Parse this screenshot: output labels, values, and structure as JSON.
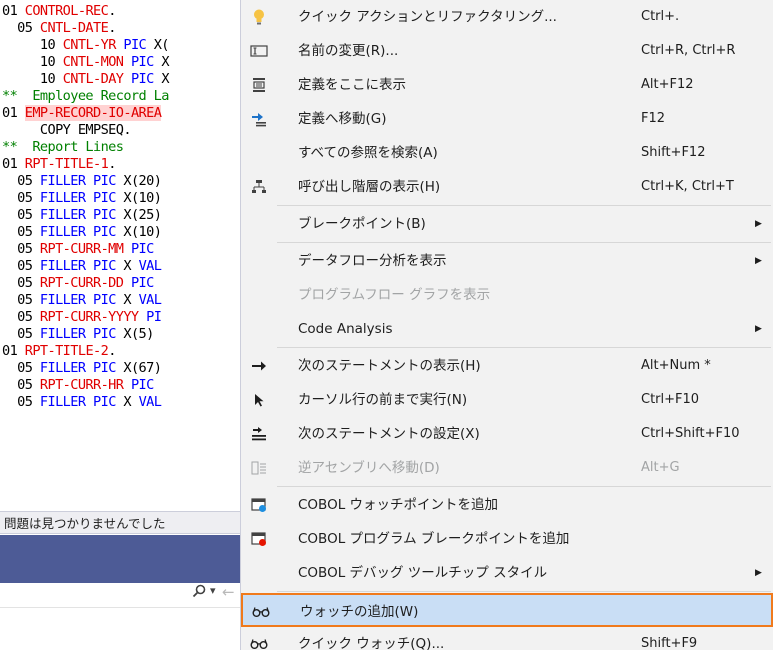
{
  "editor": {
    "lines": [
      [
        {
          "t": "01 ",
          "c": "blk"
        },
        {
          "t": "CONTROL-REC",
          "c": "red"
        },
        {
          "t": ".",
          "c": "blk"
        }
      ],
      [
        {
          "t": "  05 ",
          "c": "blk"
        },
        {
          "t": "CNTL-DATE",
          "c": "red"
        },
        {
          "t": ".",
          "c": "blk"
        }
      ],
      [
        {
          "t": "     10 ",
          "c": "blk"
        },
        {
          "t": "CNTL-YR",
          "c": "red"
        },
        {
          "t": " ",
          "c": "blk"
        },
        {
          "t": "PIC",
          "c": "blue"
        },
        {
          "t": " X(",
          "c": "blk"
        }
      ],
      [
        {
          "t": "     10 ",
          "c": "blk"
        },
        {
          "t": "CNTL-MON",
          "c": "red"
        },
        {
          "t": " ",
          "c": "blk"
        },
        {
          "t": "PIC",
          "c": "blue"
        },
        {
          "t": " X",
          "c": "blk"
        }
      ],
      [
        {
          "t": "     10 ",
          "c": "blk"
        },
        {
          "t": "CNTL-DAY",
          "c": "red"
        },
        {
          "t": " ",
          "c": "blk"
        },
        {
          "t": "PIC",
          "c": "blue"
        },
        {
          "t": " X",
          "c": "blk"
        }
      ],
      [
        {
          "t": "**  Employee Record La",
          "c": "green"
        }
      ],
      [
        {
          "t": "01 ",
          "c": "blk"
        },
        {
          "t": "EMP-RECORD-IO-AREA",
          "c": "red",
          "h": true
        }
      ],
      [
        {
          "t": "     COPY EMPSEQ.",
          "c": "blk"
        }
      ],
      [
        {
          "t": "**  Report Lines",
          "c": "green"
        }
      ],
      [
        {
          "t": "01 ",
          "c": "blk"
        },
        {
          "t": "RPT-TITLE-1",
          "c": "red"
        },
        {
          "t": ".",
          "c": "blk"
        }
      ],
      [
        {
          "t": "  05 ",
          "c": "blk"
        },
        {
          "t": "FILLER",
          "c": "blue"
        },
        {
          "t": " ",
          "c": "blk"
        },
        {
          "t": "PIC",
          "c": "blue"
        },
        {
          "t": " X(20)",
          "c": "blk"
        }
      ],
      [
        {
          "t": "  05 ",
          "c": "blk"
        },
        {
          "t": "FILLER",
          "c": "blue"
        },
        {
          "t": " ",
          "c": "blk"
        },
        {
          "t": "PIC",
          "c": "blue"
        },
        {
          "t": " X(10)",
          "c": "blk"
        }
      ],
      [
        {
          "t": "  05 ",
          "c": "blk"
        },
        {
          "t": "FILLER",
          "c": "blue"
        },
        {
          "t": " ",
          "c": "blk"
        },
        {
          "t": "PIC",
          "c": "blue"
        },
        {
          "t": " X(25)",
          "c": "blk"
        }
      ],
      [
        {
          "t": "  05 ",
          "c": "blk"
        },
        {
          "t": "FILLER",
          "c": "blue"
        },
        {
          "t": " ",
          "c": "blk"
        },
        {
          "t": "PIC",
          "c": "blue"
        },
        {
          "t": " X(10)",
          "c": "blk"
        }
      ],
      [
        {
          "t": "  05 ",
          "c": "blk"
        },
        {
          "t": "RPT-CURR-MM",
          "c": "red"
        },
        {
          "t": " ",
          "c": "blk"
        },
        {
          "t": "PIC",
          "c": "blue"
        }
      ],
      [
        {
          "t": "  05 ",
          "c": "blk"
        },
        {
          "t": "FILLER",
          "c": "blue"
        },
        {
          "t": " ",
          "c": "blk"
        },
        {
          "t": "PIC",
          "c": "blue"
        },
        {
          "t": " X ",
          "c": "blk"
        },
        {
          "t": "VAL",
          "c": "blue"
        }
      ],
      [
        {
          "t": "  05 ",
          "c": "blk"
        },
        {
          "t": "RPT-CURR-DD",
          "c": "red"
        },
        {
          "t": " ",
          "c": "blk"
        },
        {
          "t": "PIC",
          "c": "blue"
        }
      ],
      [
        {
          "t": "  05 ",
          "c": "blk"
        },
        {
          "t": "FILLER",
          "c": "blue"
        },
        {
          "t": " ",
          "c": "blk"
        },
        {
          "t": "PIC",
          "c": "blue"
        },
        {
          "t": " X ",
          "c": "blk"
        },
        {
          "t": "VAL",
          "c": "blue"
        }
      ],
      [
        {
          "t": "  05 ",
          "c": "blk"
        },
        {
          "t": "RPT-CURR-YYYY",
          "c": "red"
        },
        {
          "t": " ",
          "c": "blk"
        },
        {
          "t": "PI",
          "c": "blue"
        }
      ],
      [
        {
          "t": "  05 ",
          "c": "blk"
        },
        {
          "t": "FILLER",
          "c": "blue"
        },
        {
          "t": " ",
          "c": "blk"
        },
        {
          "t": "PIC",
          "c": "blue"
        },
        {
          "t": " X(5)",
          "c": "blk"
        }
      ],
      [
        {
          "t": "01 ",
          "c": "blk"
        },
        {
          "t": "RPT-TITLE-2",
          "c": "red"
        },
        {
          "t": ".",
          "c": "blk"
        }
      ],
      [
        {
          "t": "  05 ",
          "c": "blk"
        },
        {
          "t": "FILLER",
          "c": "blue"
        },
        {
          "t": " ",
          "c": "blk"
        },
        {
          "t": "PIC",
          "c": "blue"
        },
        {
          "t": " X(67)",
          "c": "blk"
        }
      ],
      [
        {
          "t": "  05 ",
          "c": "blk"
        },
        {
          "t": "RPT-CURR-HR",
          "c": "red"
        },
        {
          "t": " ",
          "c": "blk"
        },
        {
          "t": "PIC",
          "c": "blue"
        }
      ],
      [
        {
          "t": "  05 ",
          "c": "blk"
        },
        {
          "t": "FILLER",
          "c": "blue"
        },
        {
          "t": " ",
          "c": "blk"
        },
        {
          "t": "PIC",
          "c": "blue"
        },
        {
          "t": " X ",
          "c": "blk"
        },
        {
          "t": "VAL",
          "c": "blue"
        }
      ]
    ]
  },
  "problems": {
    "status": "問題は見つかりませんでした"
  },
  "search": {
    "icon": "search-icon",
    "dropdown": "▾",
    "back": "←"
  },
  "menu": {
    "items": [
      {
        "label": "クイック アクションとリファクタリング...",
        "shortcut": "Ctrl+.",
        "icon": "lightbulb-icon",
        "submenu": false,
        "disabled": false
      },
      {
        "label": "名前の変更(R)...",
        "shortcut": "Ctrl+R, Ctrl+R",
        "icon": "rename-icon",
        "submenu": false,
        "disabled": false
      },
      {
        "label": "定義をここに表示",
        "shortcut": "Alt+F12",
        "icon": "peek-definition-icon",
        "submenu": false,
        "disabled": false
      },
      {
        "label": "定義へ移動(G)",
        "shortcut": "F12",
        "icon": "go-to-definition-icon",
        "submenu": false,
        "disabled": false
      },
      {
        "label": "すべての参照を検索(A)",
        "shortcut": "Shift+F12",
        "icon": "",
        "submenu": false,
        "disabled": false
      },
      {
        "label": "呼び出し階層の表示(H)",
        "shortcut": "Ctrl+K, Ctrl+T",
        "icon": "call-hierarchy-icon",
        "submenu": false,
        "disabled": false
      },
      {
        "sep": true
      },
      {
        "label": "ブレークポイント(B)",
        "shortcut": "",
        "icon": "",
        "submenu": true,
        "disabled": false
      },
      {
        "sep": true
      },
      {
        "label": "データフロー分析を表示",
        "shortcut": "",
        "icon": "",
        "submenu": true,
        "disabled": false
      },
      {
        "label": "プログラムフロー グラフを表示",
        "shortcut": "",
        "icon": "",
        "submenu": false,
        "disabled": true
      },
      {
        "label": "Code Analysis",
        "shortcut": "",
        "icon": "",
        "submenu": true,
        "disabled": false
      },
      {
        "sep": true
      },
      {
        "label": "次のステートメントの表示(H)",
        "shortcut": "Alt+Num *",
        "icon": "show-next-statement-icon",
        "submenu": false,
        "disabled": false
      },
      {
        "label": "カーソル行の前まで実行(N)",
        "shortcut": "Ctrl+F10",
        "icon": "run-to-cursor-icon",
        "submenu": false,
        "disabled": false
      },
      {
        "label": "次のステートメントの設定(X)",
        "shortcut": "Ctrl+Shift+F10",
        "icon": "set-next-statement-icon",
        "submenu": false,
        "disabled": false
      },
      {
        "label": "逆アセンブリへ移動(D)",
        "shortcut": "Alt+G",
        "icon": "disassembly-icon",
        "submenu": false,
        "disabled": true
      },
      {
        "sep": true
      },
      {
        "label": "COBOL ウォッチポイントを追加",
        "shortcut": "",
        "icon": "watchpoint-icon",
        "submenu": false,
        "disabled": false
      },
      {
        "label": "COBOL プログラム ブレークポイントを追加",
        "shortcut": "",
        "icon": "program-breakpoint-icon",
        "submenu": false,
        "disabled": false
      },
      {
        "label": "COBOL デバッグ ツールチップ スタイル",
        "shortcut": "",
        "icon": "",
        "submenu": true,
        "disabled": false
      },
      {
        "sep": true
      },
      {
        "label": "ウォッチの追加(W)",
        "shortcut": "",
        "icon": "glasses-icon",
        "submenu": false,
        "disabled": false,
        "selected": true
      },
      {
        "label": "クイック ウォッチ(Q)...",
        "shortcut": "Shift+F9",
        "icon": "glasses-icon",
        "submenu": false,
        "disabled": false
      }
    ]
  },
  "colors": {
    "menu_bg": "#f2f2f2",
    "selected_bg": "#c9def5",
    "selected_border": "#f07a1c",
    "panel_header": "#4d5b96",
    "cobol_red": "#e00000",
    "cobol_blue": "#0000ff",
    "cobol_green": "#008000"
  }
}
